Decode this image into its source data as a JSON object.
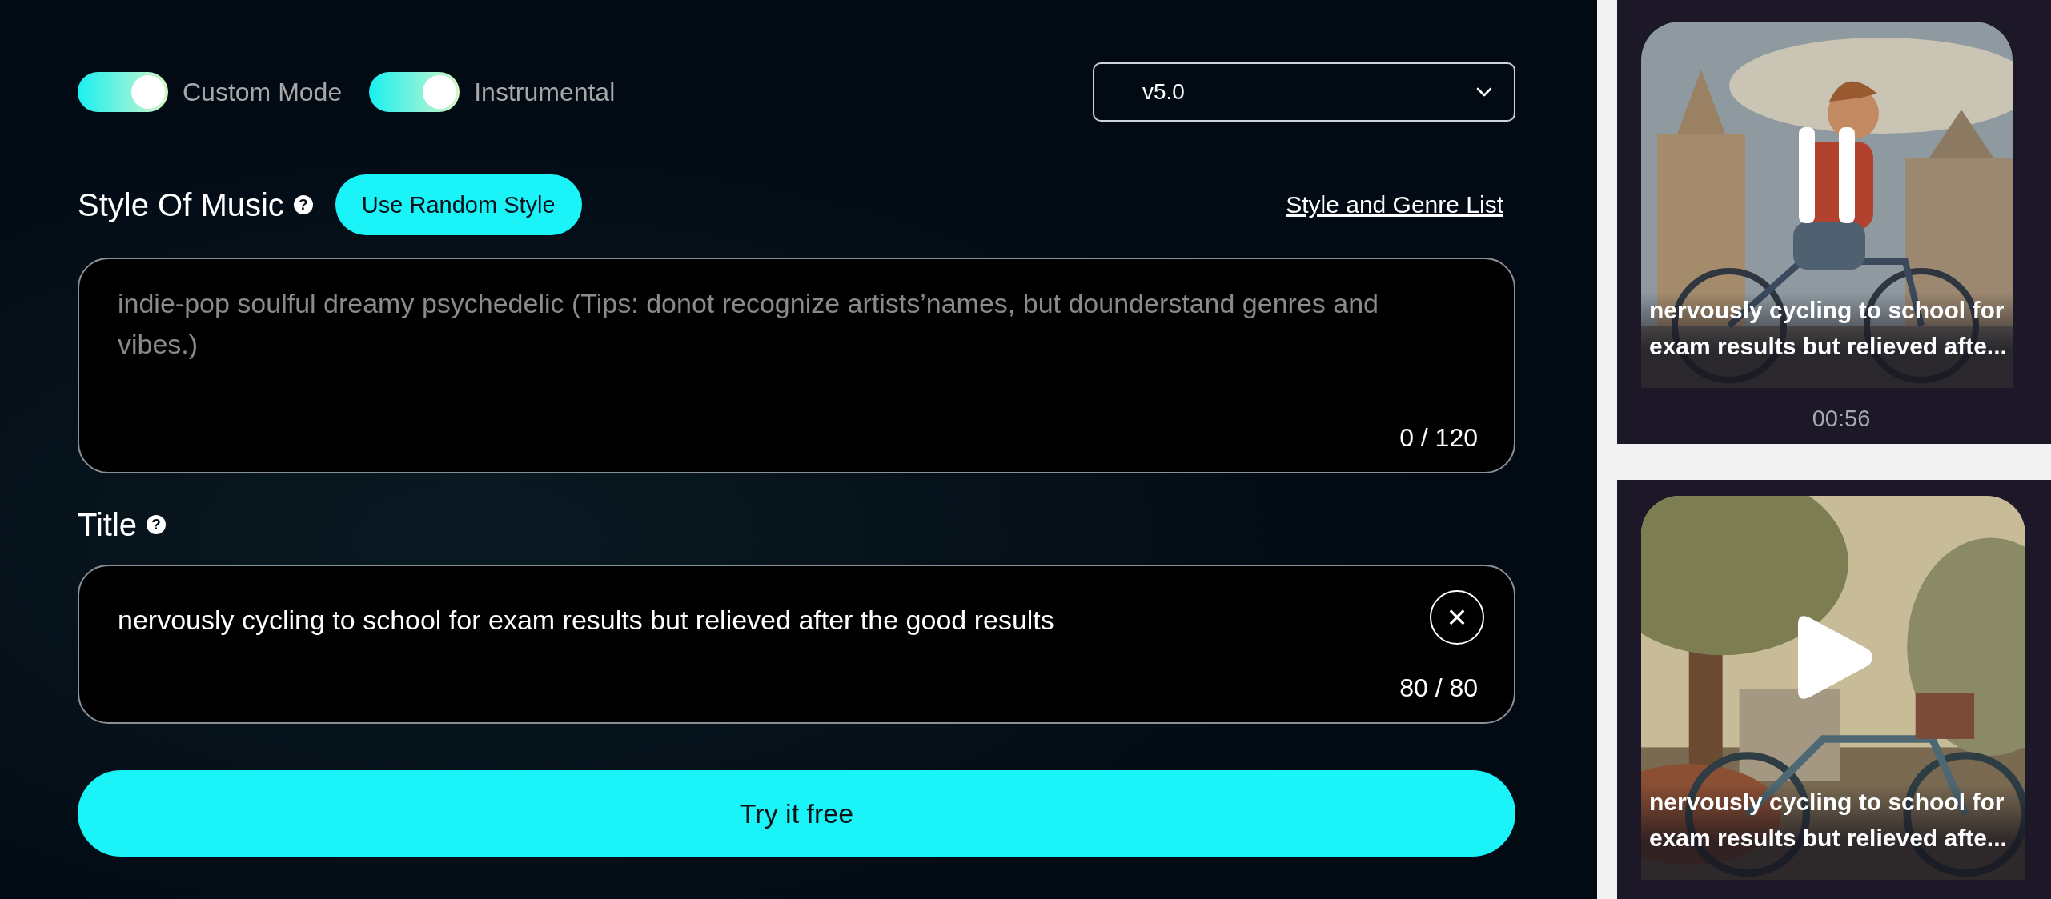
{
  "mode_bar": {
    "toggles": [
      {
        "label": "Custom Mode",
        "on": true
      },
      {
        "label": "Instrumental",
        "on": true
      }
    ],
    "version_select": {
      "value": "v5.0"
    }
  },
  "style_section": {
    "label": "Style Of Music",
    "help_icon": "?",
    "random_button": "Use Random Style",
    "genre_link": "Style and Genre List",
    "field": {
      "placeholder": "indie-pop soulful dreamy psychedelic (Tips: donot recognize artists’names, but dounderstand genres and vibes.)",
      "counter": "0 / 120"
    }
  },
  "title_section": {
    "label": "Title",
    "help_icon": "?",
    "field": {
      "value": "nervously cycling to school for exam results but relieved after the good results",
      "counter": "80 / 80",
      "clear_button": "×"
    }
  },
  "submit_button": "Try it free",
  "songs": [
    {
      "caption": "nervously cycling to school for exam results but relieved afte...",
      "playing": true,
      "duration": "00:56"
    },
    {
      "caption": "nervously cycling to school for exam results but relieved afte...",
      "playing": false
    }
  ]
}
